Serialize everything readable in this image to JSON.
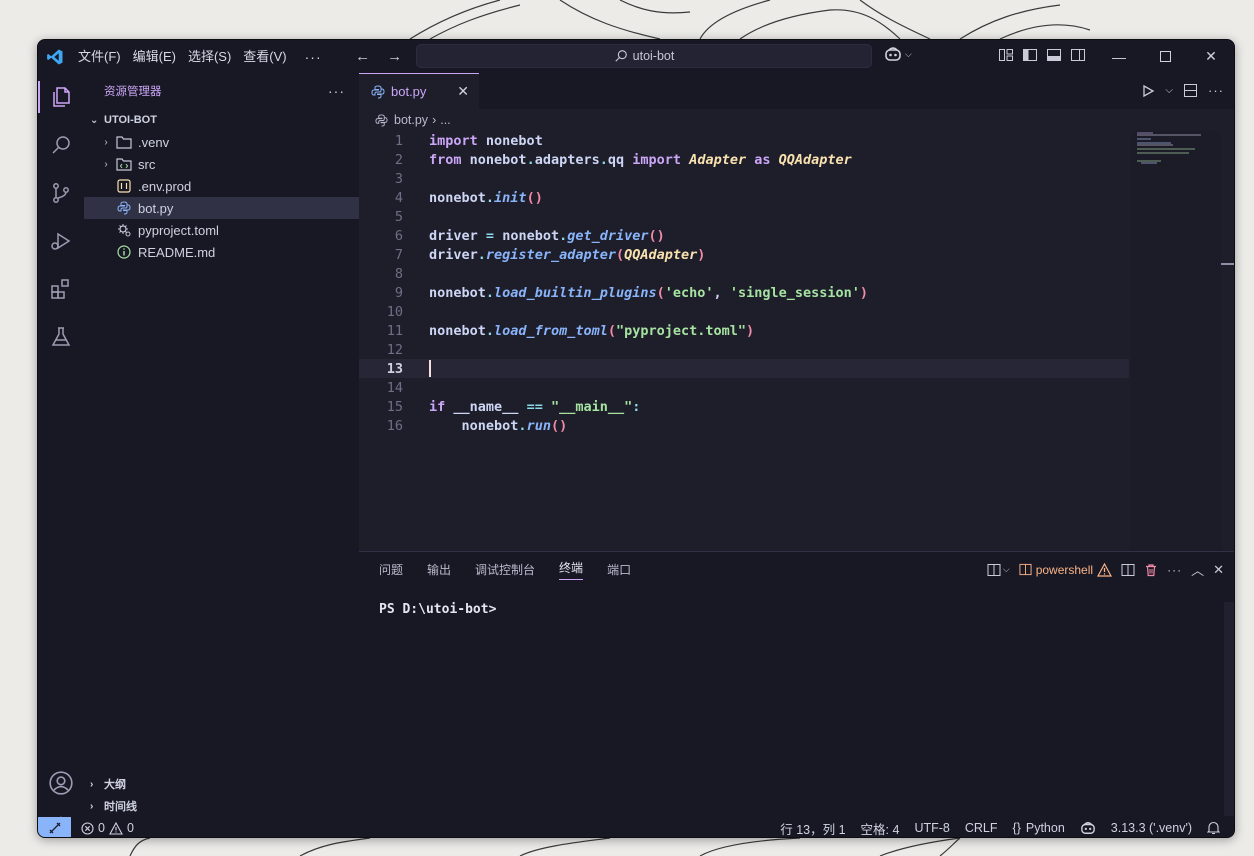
{
  "titlebar": {
    "menus": [
      "文件(F)",
      "编辑(E)",
      "选择(S)",
      "查看(V)"
    ],
    "more": "···",
    "search_text": "utoi-bot"
  },
  "sidebar": {
    "title": "资源管理器",
    "more": "···",
    "folder": "UTOI-BOT",
    "items": [
      {
        "label": ".venv",
        "icon": "folder-icon",
        "expandable": true
      },
      {
        "label": "src",
        "icon": "folder-code-icon",
        "expandable": true
      },
      {
        "label": ".env.prod",
        "icon": "env-file-icon",
        "expandable": false
      },
      {
        "label": "bot.py",
        "icon": "python-file-icon",
        "expandable": false,
        "selected": true
      },
      {
        "label": "pyproject.toml",
        "icon": "toml-file-icon",
        "expandable": false
      },
      {
        "label": "README.md",
        "icon": "info-file-icon",
        "expandable": false
      }
    ],
    "outline": "大纲",
    "timeline": "时间线"
  },
  "editor": {
    "tab_label": "bot.py",
    "breadcrumb_file": "bot.py",
    "breadcrumb_rest": "...",
    "current_line": 13,
    "line_numbers": [
      "1",
      "2",
      "3",
      "4",
      "5",
      "6",
      "7",
      "8",
      "9",
      "10",
      "11",
      "12",
      "13",
      "14",
      "15",
      "16"
    ]
  },
  "panel": {
    "tabs": [
      "问题",
      "输出",
      "调试控制台",
      "终端",
      "端口"
    ],
    "active_tab": "终端",
    "shell": "powershell",
    "prompt": "PS D:\\utoi-bot>"
  },
  "statusbar": {
    "errors": "0",
    "warnings": "0",
    "position": "行 13，列 1",
    "spaces": "空格: 4",
    "encoding": "UTF-8",
    "eol": "CRLF",
    "language": "Python",
    "interpreter": "3.13.3 ('.venv')"
  },
  "colors": {
    "accent": "#cba6f7",
    "editor_bg": "#1e1e2b",
    "sidebar_bg": "#181825",
    "remote_bg": "#89b4fa"
  }
}
